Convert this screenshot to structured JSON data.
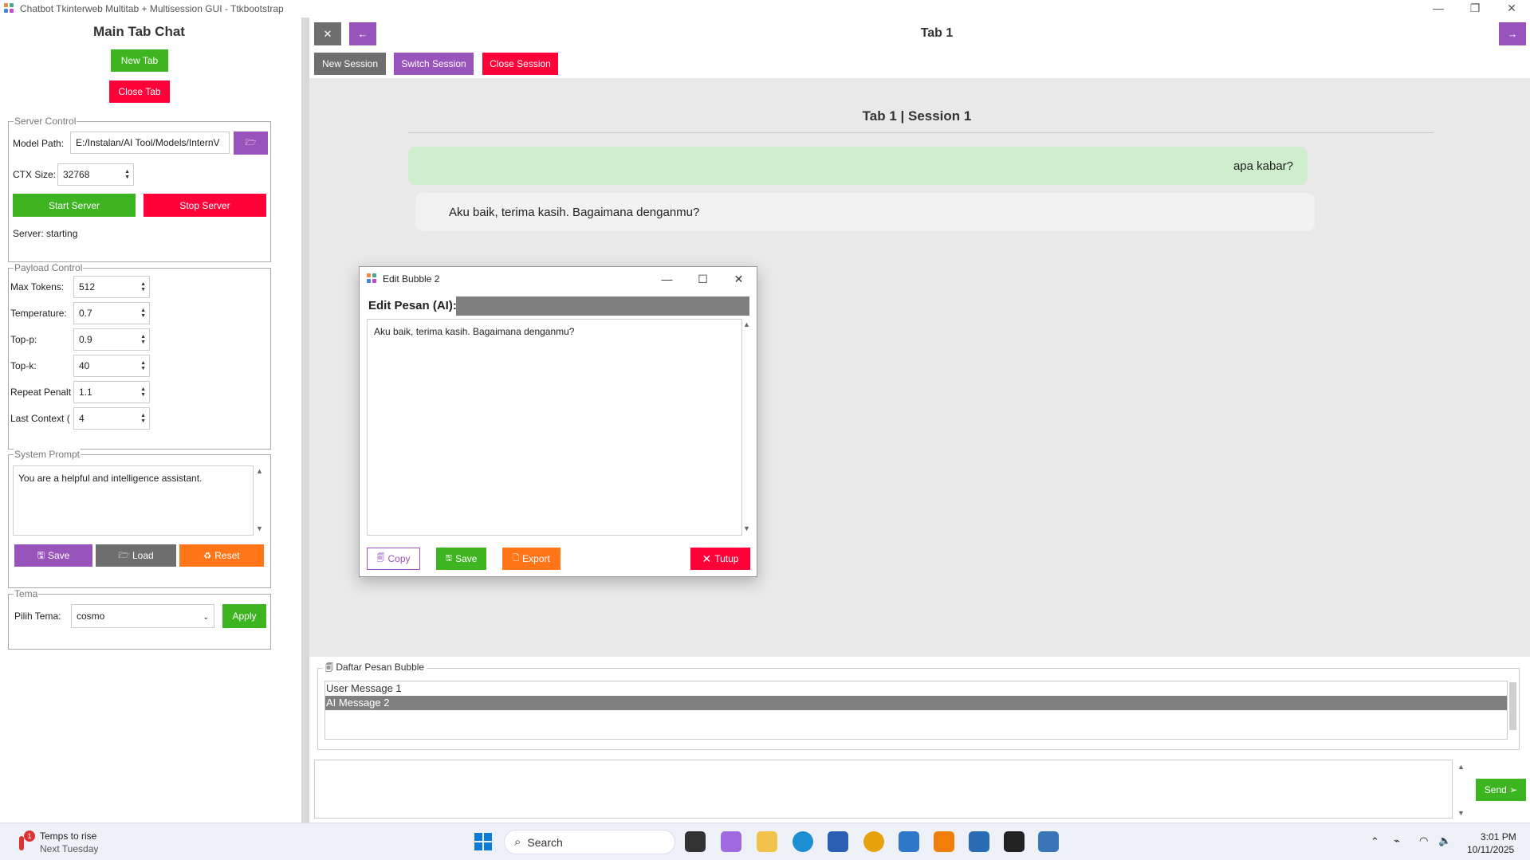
{
  "window": {
    "title": "Chatbot Tkinterweb Multitab + Multisession GUI - Ttkbootstrap",
    "minimize": "—",
    "restore": "❐",
    "close": "✕"
  },
  "left": {
    "title": "Main Tab Chat",
    "new_tab": "New Tab",
    "close_tab": "Close Tab",
    "server": {
      "legend": "Server Control",
      "model_path_label": "Model Path:",
      "model_path_value": "E:/Instalan/AI Tool/Models/InternV",
      "ctx_label": "CTX Size:",
      "ctx_value": "32768",
      "start": "Start Server",
      "stop": "Stop Server",
      "status": "Server: starting"
    },
    "payload": {
      "legend": "Payload Control",
      "fields": [
        {
          "label": "Max Tokens:",
          "value": "512"
        },
        {
          "label": "Temperature:",
          "value": "0.7"
        },
        {
          "label": "Top-p:",
          "value": "0.9"
        },
        {
          "label": "Top-k:",
          "value": "40"
        },
        {
          "label": "Repeat Penalt",
          "value": "1.1"
        },
        {
          "label": "Last Context (",
          "value": "4"
        }
      ]
    },
    "system_prompt": {
      "legend": "System Prompt",
      "text": "You are a helpful and intelligence assistant.",
      "save": "Save",
      "load": "Load",
      "reset": "Reset"
    },
    "theme": {
      "legend": "Tema",
      "label": "Pilih Tema:",
      "value": "cosmo",
      "apply": "Apply"
    }
  },
  "main": {
    "close_tab_icon": "✕",
    "back_icon": "←",
    "forward_icon": "→",
    "tab_title": "Tab 1",
    "new_session": "New Session",
    "switch_session": "Switch Session",
    "close_session": "Close Session",
    "session_title": "Tab 1 | Session 1",
    "messages": {
      "user": "apa kabar?",
      "ai": "Aku baik, terima kasih. Bagaimana denganmu?"
    },
    "bubble_list": {
      "legend": "Daftar Pesan Bubble",
      "items": [
        "User Message 1",
        "AI Message 2"
      ]
    },
    "send": "Send ➢"
  },
  "dialog": {
    "title": "Edit Bubble 2",
    "label": "Edit Pesan (AI):",
    "text": "Aku baik, terima kasih. Bagaimana denganmu?",
    "copy": "Copy",
    "save": "Save",
    "export": "Export",
    "close": "Tutup"
  },
  "taskbar": {
    "weather_title": "Temps to rise",
    "weather_sub": "Next Tuesday",
    "weather_badge": "1",
    "search": "Search",
    "time": "3:01 PM",
    "date": "10/11/2025"
  },
  "colors": {
    "primary": "#9954bb",
    "success": "#3cb521",
    "danger": "#ff0039",
    "warning": "#ff7518",
    "secondary": "#6e6e6e"
  }
}
